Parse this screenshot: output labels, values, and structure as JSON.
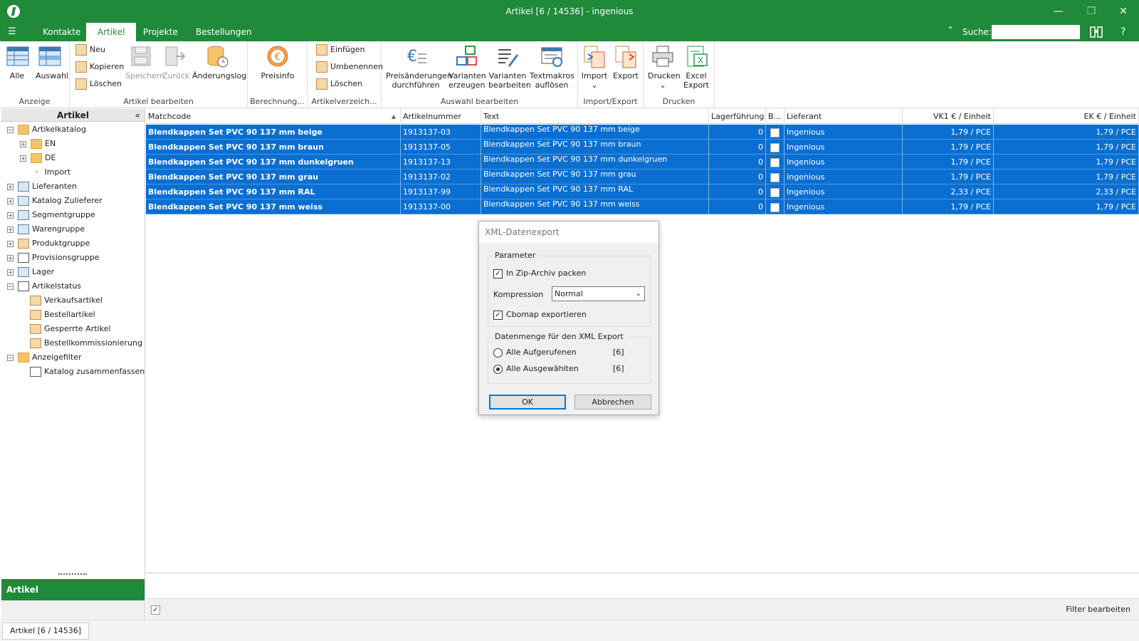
{
  "window": {
    "title": "Artikel [6 / 14536] - ingenious"
  },
  "menubar": {
    "tabs": [
      {
        "label": "Kontakte",
        "active": false
      },
      {
        "label": "Artikel",
        "active": true
      },
      {
        "label": "Projekte",
        "active": false
      },
      {
        "label": "Bestellungen",
        "active": false
      }
    ],
    "search_label": "Suche:",
    "search_value": "",
    "help": "?"
  },
  "ribbon": {
    "groups": {
      "anzeige": "Anzeige",
      "artikel_bearbeiten": "Artikel bearbeiten",
      "berechnung": "Berechnung...",
      "artikelverzeichnis": "Artikelverzeich...",
      "auswahl_bearbeiten": "Auswahl bearbeiten",
      "import_export": "Import/Export",
      "drucken": "Drucken"
    },
    "buttons": {
      "alle": "Alle",
      "auswahl": "Auswahl",
      "neu": "Neu",
      "kopieren": "Kopieren",
      "loeschen": "Löschen",
      "speichern": "Speichern",
      "zurueck": "Zurück",
      "aenderungslog": "Änderungslog",
      "preisinfo": "Preisinfo",
      "einfuegen": "Einfügen",
      "umbenennen": "Umbenennen",
      "loeschen2": "Löschen",
      "preisaenderungen_1": "Preisänderungen",
      "preisaenderungen_2": "durchführen",
      "varianten_erzeugen_1": "Varianten",
      "varianten_erzeugen_2": "erzeugen",
      "varianten_bearbeiten_1": "Varianten",
      "varianten_bearbeiten_2": "bearbeiten",
      "textmakros_1": "Textmakros",
      "textmakros_2": "auflösen",
      "import": "Import",
      "export": "Export",
      "drucken": "Drucken",
      "excel_1": "Excel",
      "excel_2": "Export"
    }
  },
  "sidebar": {
    "title": "Artikel",
    "tree": {
      "artikelkatalog": "Artikelkatalog",
      "en": "EN",
      "de": "DE",
      "import": "Import",
      "lieferanten": "Lieferanten",
      "katalog_zulieferer": "Katalog Zulieferer",
      "segmentgruppe": "Segmentgruppe",
      "warengruppe": "Warengruppe",
      "produktgruppe": "Produktgruppe",
      "provisionsgruppe": "Provisionsgruppe",
      "lager": "Lager",
      "artikelstatus": "Artikelstatus",
      "verkaufsartikel": "Verkaufsartikel",
      "bestellartikel": "Bestellartikel",
      "gesperrte_artikel": "Gesperrte Artikel",
      "bestellkommissionierung": "Bestellkommissionierung",
      "anzeigefilter": "Anzeigefilter",
      "katalog_zusammenfassen": "Katalog zusammenfassen"
    },
    "nav_tab": "Artikel"
  },
  "grid": {
    "columns": {
      "matchcode": "Matchcode",
      "artikelnummer": "Artikelnummer",
      "text": "Text",
      "lagerfuehrung": "Lagerführung",
      "b": "B...",
      "lieferant": "Lieferant",
      "vk1": "VK1 € / Einheit",
      "ek": "EK € / Einheit"
    },
    "rows": [
      {
        "matchcode": "Blendkappen Set PVC 90 137 mm beige",
        "artikelnummer": "1913137-03",
        "text": "Blendkappen Set PVC 90 137 mm beige",
        "lager": "0",
        "lieferant": "Ingenious",
        "vk1": "1,79 / PCE",
        "ek": "1,79 / PCE"
      },
      {
        "matchcode": "Blendkappen Set PVC 90 137 mm braun",
        "artikelnummer": "1913137-05",
        "text": "Blendkappen Set PVC 90 137 mm braun",
        "lager": "0",
        "lieferant": "Ingenious",
        "vk1": "1,79 / PCE",
        "ek": "1,79 / PCE"
      },
      {
        "matchcode": "Blendkappen Set PVC 90 137 mm dunkelgruen",
        "artikelnummer": "1913137-13",
        "text": "Blendkappen Set PVC 90 137 mm dunkelgruen",
        "lager": "0",
        "lieferant": "Ingenious",
        "vk1": "1,79 / PCE",
        "ek": "1,79 / PCE"
      },
      {
        "matchcode": "Blendkappen Set PVC 90 137 mm grau",
        "artikelnummer": "1913137-02",
        "text": "Blendkappen Set PVC 90 137 mm grau",
        "lager": "0",
        "lieferant": "Ingenious",
        "vk1": "1,79 / PCE",
        "ek": "1,79 / PCE"
      },
      {
        "matchcode": "Blendkappen Set PVC 90 137 mm RAL",
        "artikelnummer": "1913137-99",
        "text": "Blendkappen Set PVC 90 137 mm RAL",
        "lager": "0",
        "lieferant": "Ingenious",
        "vk1": "2,33 / PCE",
        "ek": "2,33 / PCE"
      },
      {
        "matchcode": "Blendkappen Set PVC 90 137 mm weiss",
        "artikelnummer": "1913137-00",
        "text": "Blendkappen Set PVC 90 137 mm weiss",
        "lager": "0",
        "lieferant": "Ingenious",
        "vk1": "1,79 / PCE",
        "ek": "1,79 / PCE"
      }
    ]
  },
  "filterbar": {
    "edit": "Filter bearbeiten"
  },
  "bottombar": {
    "doc_tab": "Artikel [6 / 14536]"
  },
  "dialog": {
    "title": "XML-Datenexport",
    "parameter_group": "Parameter",
    "zip_label": "In Zip-Archiv packen",
    "zip_checked": true,
    "kompression_label": "Kompression",
    "kompression_value": "Normal",
    "cbomap_label": "Cbomap exportieren",
    "cbomap_checked": true,
    "datenmenge_group": "Datenmenge für den XML Export",
    "radio_alle_aufgerufenen": "Alle Aufgerufenen",
    "count_aufgerufenen": "[6]",
    "radio_alle_ausgewaehlten": "Alle Ausgewählten",
    "count_ausgewaehlten": "[6]",
    "selected_radio": "alle_ausgewaehlten",
    "ok": "OK",
    "abbrechen": "Abbrechen"
  },
  "colors": {
    "accent": "#1f8a3a",
    "selection": "#0a6fd1"
  }
}
